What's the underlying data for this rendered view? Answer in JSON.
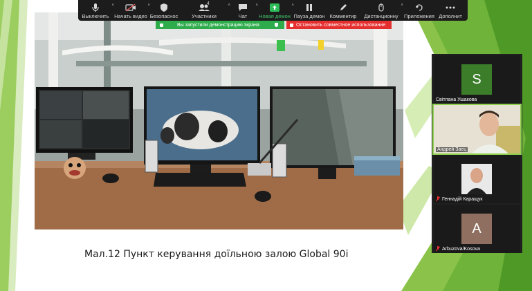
{
  "toolbar": {
    "items": [
      {
        "label": "Выключить"
      },
      {
        "label": "Начать видео"
      },
      {
        "label": "Безопаснос"
      },
      {
        "label": "Участники",
        "count": "4"
      },
      {
        "label": "Чат"
      },
      {
        "label": "Новая демон"
      },
      {
        "label": "Пауза демон"
      },
      {
        "label": "Комментир"
      },
      {
        "label": "Дистанционну"
      },
      {
        "label": "Приложения"
      },
      {
        "label": "Дополнит"
      }
    ]
  },
  "share_banner": {
    "status": "Вы запустили демонстрацию экрана",
    "stop": "Остановить совместное использование"
  },
  "slide": {
    "caption": "Мал.12 Пункт керування доїльною залою Global 90i"
  },
  "participants": [
    {
      "name": "Світлана Ушакова",
      "initial": "S",
      "avatar_color": "#3c7d2a",
      "muted": false
    },
    {
      "name": "Андрей Заец",
      "initial": "",
      "muted": false,
      "speaking": true
    },
    {
      "name": "Геннадій Каращук",
      "initial": "",
      "muted": true
    },
    {
      "name": "Arbuzova/Kosova",
      "initial": "A",
      "avatar_color": "#8f7060",
      "muted": true
    }
  ],
  "colors": {
    "toolbar_bg": "#1c1c1c",
    "share_green": "#2eac4c",
    "share_red": "#e52f2f",
    "slide_green": "#7ec242"
  }
}
